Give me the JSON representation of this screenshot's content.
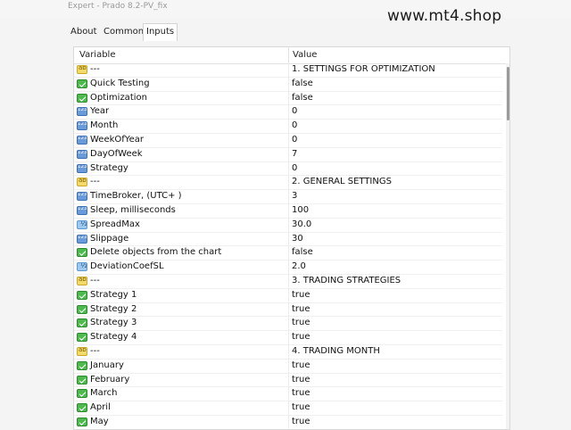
{
  "window": {
    "title": "Expert - Prado 8.2-PV_fix"
  },
  "watermark": "www.mt4.shop",
  "tabs": [
    {
      "label": "About"
    },
    {
      "label": "Common"
    },
    {
      "label": "Inputs"
    }
  ],
  "table": {
    "headers": {
      "variable": "Variable",
      "value": "Value"
    },
    "rows": [
      {
        "icon": "string-type-icon",
        "name": "---",
        "value": "1. SETTINGS FOR OPTIMIZATION"
      },
      {
        "icon": "bool-type-icon",
        "name": "Quick Testing",
        "value": "false"
      },
      {
        "icon": "bool-type-icon",
        "name": "Optimization",
        "value": "false"
      },
      {
        "icon": "int-type-icon",
        "name": "Year",
        "value": "0"
      },
      {
        "icon": "int-type-icon",
        "name": "Month",
        "value": "0"
      },
      {
        "icon": "int-type-icon",
        "name": "WeekOfYear",
        "value": "0"
      },
      {
        "icon": "int-type-icon",
        "name": "DayOfWeek",
        "value": "7"
      },
      {
        "icon": "int-type-icon",
        "name": "Strategy",
        "value": "0"
      },
      {
        "icon": "string-type-icon",
        "name": "---",
        "value": "2. GENERAL SETTINGS"
      },
      {
        "icon": "int-type-icon",
        "name": "TimeBroker, (UTC+ )",
        "value": "3"
      },
      {
        "icon": "int-type-icon",
        "name": "Sleep, milliseconds",
        "value": "100"
      },
      {
        "icon": "double-type-icon",
        "name": "SpreadMax",
        "value": "30.0"
      },
      {
        "icon": "int-type-icon",
        "name": "Slippage",
        "value": "30"
      },
      {
        "icon": "bool-type-icon",
        "name": "Delete objects from the chart",
        "value": "false"
      },
      {
        "icon": "double-type-icon",
        "name": "DeviationCoefSL",
        "value": "2.0"
      },
      {
        "icon": "string-type-icon",
        "name": "---",
        "value": "3. TRADING STRATEGIES"
      },
      {
        "icon": "bool-type-icon",
        "name": "Strategy 1",
        "value": "true"
      },
      {
        "icon": "bool-type-icon",
        "name": "Strategy 2",
        "value": "true"
      },
      {
        "icon": "bool-type-icon",
        "name": "Strategy 3",
        "value": "true"
      },
      {
        "icon": "bool-type-icon",
        "name": "Strategy 4",
        "value": "true"
      },
      {
        "icon": "string-type-icon",
        "name": "---",
        "value": "4. TRADING MONTH"
      },
      {
        "icon": "bool-type-icon",
        "name": "January",
        "value": "true"
      },
      {
        "icon": "bool-type-icon",
        "name": "February",
        "value": "true"
      },
      {
        "icon": "bool-type-icon",
        "name": "March",
        "value": "true"
      },
      {
        "icon": "bool-type-icon",
        "name": "April",
        "value": "true"
      },
      {
        "icon": "bool-type-icon",
        "name": "May",
        "value": "true"
      }
    ]
  }
}
